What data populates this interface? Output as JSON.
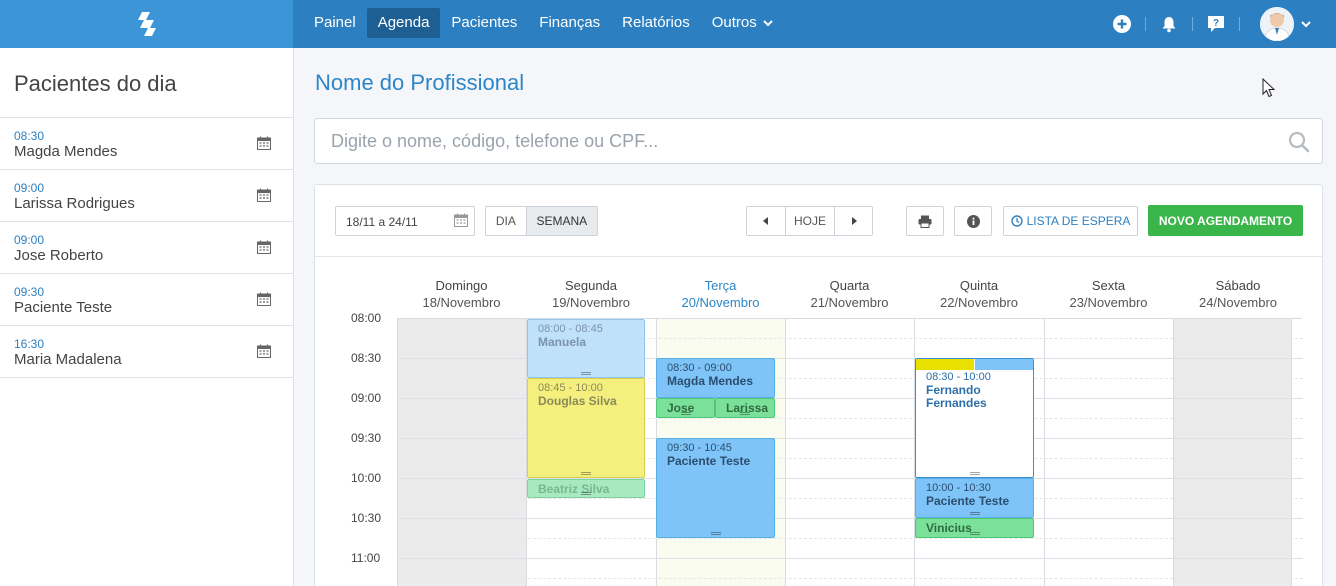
{
  "nav": {
    "items": [
      "Painel",
      "Agenda",
      "Pacientes",
      "Finanças",
      "Relatórios",
      "Outros"
    ],
    "active": "Agenda"
  },
  "sidebar": {
    "title": "Pacientes do dia",
    "items": [
      {
        "time": "08:30",
        "name": "Magda Mendes"
      },
      {
        "time": "09:00",
        "name": "Larissa Rodrigues"
      },
      {
        "time": "09:00",
        "name": "Jose Roberto"
      },
      {
        "time": "09:30",
        "name": "Paciente Teste"
      },
      {
        "time": "16:30",
        "name": "Maria Madalena"
      }
    ]
  },
  "main": {
    "title": "Nome do Profissional",
    "search_placeholder": "Digite o nome, código, telefone ou CPF..."
  },
  "toolbar": {
    "date_range": "18/11 a 24/11",
    "view_day": "DIA",
    "view_week": "SEMANA",
    "today": "HOJE",
    "waitlist": "LISTA DE ESPERA",
    "new_appointment": "NOVO AGENDAMENTO"
  },
  "calendar": {
    "days": [
      {
        "name": "Domingo",
        "date": "18/Novembro"
      },
      {
        "name": "Segunda",
        "date": "19/Novembro"
      },
      {
        "name": "Terça",
        "date": "20/Novembro"
      },
      {
        "name": "Quarta",
        "date": "21/Novembro"
      },
      {
        "name": "Quinta",
        "date": "22/Novembro"
      },
      {
        "name": "Sexta",
        "date": "23/Novembro"
      },
      {
        "name": "Sábado",
        "date": "24/Novembro"
      }
    ],
    "times": [
      "08:00",
      "08:30",
      "09:00",
      "09:30",
      "10:00",
      "10:30",
      "11:00"
    ],
    "events": {
      "manuela": {
        "time": "08:00 - 08:45",
        "name": "Manuela"
      },
      "douglas": {
        "time": "08:45 - 10:00",
        "name": "Douglas Silva"
      },
      "beatriz": {
        "name": "Beatriz Silva"
      },
      "magda": {
        "time": "08:30 - 09:00",
        "name": "Magda Mendes"
      },
      "jose": {
        "name": "Jose"
      },
      "larissa": {
        "name": "Larissa"
      },
      "paciente_ter": {
        "time": "09:30 - 10:45",
        "name": "Paciente Teste"
      },
      "fernando": {
        "time": "08:30 - 10:00",
        "name": "Fernando Fernandes"
      },
      "paciente_qui": {
        "time": "10:00 - 10:30",
        "name": "Paciente Teste"
      },
      "vinicius": {
        "name": "Vinicius"
      }
    }
  },
  "colors": {
    "topbar": "#2c7fc0",
    "accent": "#2d86c6",
    "green_button": "#3ab54a",
    "fernando_strip_left": "#e8e000",
    "fernando_strip_right": "#7fc4f8"
  },
  "icons": [
    "logo-icon",
    "chevron-down-icon",
    "plus-circle-icon",
    "bell-icon",
    "help-icon",
    "calendar-icon",
    "search-icon",
    "prev-icon",
    "next-icon",
    "print-icon",
    "info-icon",
    "clock-icon"
  ]
}
